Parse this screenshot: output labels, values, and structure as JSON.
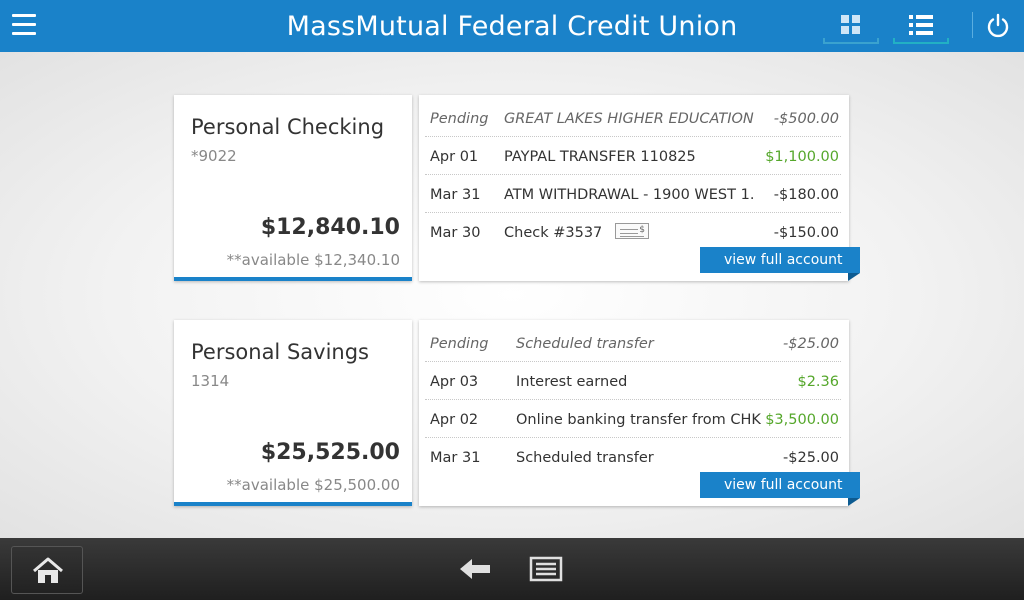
{
  "header": {
    "title": "MassMutual Federal Credit Union",
    "icons": [
      "hamburger-menu-icon",
      "grid-view-icon",
      "list-view-icon",
      "power-icon"
    ]
  },
  "accounts": [
    {
      "name": "Personal Checking",
      "number": "*9022",
      "balance": "$12,840.10",
      "available": "**available $12,340.10",
      "view_label": "view full account",
      "transactions": [
        {
          "date": "Pending",
          "description": "GREAT LAKES HIGHER EDUCATION...",
          "amount": "-$500.00",
          "pending": true
        },
        {
          "date": "Apr 01",
          "description": "PAYPAL TRANSFER 110825",
          "amount": "$1,100.00",
          "positive": true
        },
        {
          "date": "Mar 31",
          "description": "ATM WITHDRAWAL - 1900 WEST 1...",
          "amount": "-$180.00"
        },
        {
          "date": "Mar 30",
          "description": "Check #3537",
          "amount": "-$150.00",
          "check": true
        }
      ]
    },
    {
      "name": "Personal Savings",
      "number": "1314",
      "balance": "$25,525.00",
      "available": "**available $25,500.00",
      "view_label": "view full account",
      "transactions": [
        {
          "date": "Pending",
          "description": "Scheduled transfer",
          "amount": "-$25.00",
          "pending": true
        },
        {
          "date": "Apr 03",
          "description": "Interest earned",
          "amount": "$2.36",
          "positive": true
        },
        {
          "date": "Apr 02",
          "description": "Online banking transfer from CHK",
          "amount": "$3,500.00",
          "positive": true
        },
        {
          "date": "Mar 31",
          "description": "Scheduled transfer",
          "amount": "-$25.00"
        }
      ]
    }
  ],
  "check_icon_symbol": "$",
  "colors": {
    "brand_blue": "#1a82c9",
    "positive_green": "#55a72b"
  },
  "navbar": {
    "icons": [
      "home-icon",
      "back-arrow-icon",
      "menu-icon"
    ]
  }
}
